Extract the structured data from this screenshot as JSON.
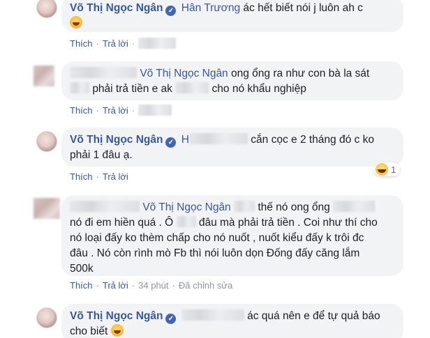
{
  "comments": [
    {
      "author": "Võ Thị Ngọc Ngân",
      "mention": "Hân Trương",
      "text_line1": "ác hết biết nói j luôn ah c",
      "actions": {
        "like": "Thích",
        "reply": "Trả lời"
      }
    },
    {
      "mention": "Võ Thị Ngọc Ngân",
      "text_line1": "ong ổng ra như con bà la sát",
      "text_line2a": "phải trả tiền e ak",
      "text_line2b": "cho nó khẩu nghiệp",
      "actions": {
        "like": "Thích",
        "reply": "Trả lời"
      }
    },
    {
      "author": "Võ Thị Ngọc Ngân",
      "mention_initial": "H",
      "text_line1": "cắn cọc e 2 tháng đó c ko",
      "text_line2": "phải 1 đâu ạ.",
      "actions": {
        "like": "Thích",
        "reply": "Trả lời"
      },
      "reaction_count": "1"
    },
    {
      "mention": "Võ Thị Ngọc Ngân",
      "text_line1": "thế nó ong ổng",
      "text_line2a": "nó đi em hiền quá . Ô",
      "text_line2b": "đâu mà phải trả tiền . Coi như thí cho",
      "text_line3": "nó loại đấy ko thèm chấp cho nó nuốt , nuốt kiểu đấy k trôi đc",
      "text_line4": "đâu . Nó còn rình mò Fb thì nói luôn dọn Đống đấy căng lắm",
      "text_line5": "500k",
      "actions": {
        "like": "Thích",
        "reply": "Trả lời",
        "time": "34 phút",
        "edited": "Đã chỉnh sửa"
      }
    },
    {
      "author": "Võ Thị Ngọc Ngân",
      "text_line1": "ác quá nên e để tự quả báo",
      "text_line2": "cho biết"
    }
  ],
  "icons": {
    "verified": "verified-check-icon",
    "emoji_cry": "crying-emoji-icon",
    "reaction": "haha-reaction-icon"
  },
  "colors": {
    "link": "#385898",
    "bubble": "#f2f3f5",
    "meta": "#90949c"
  }
}
